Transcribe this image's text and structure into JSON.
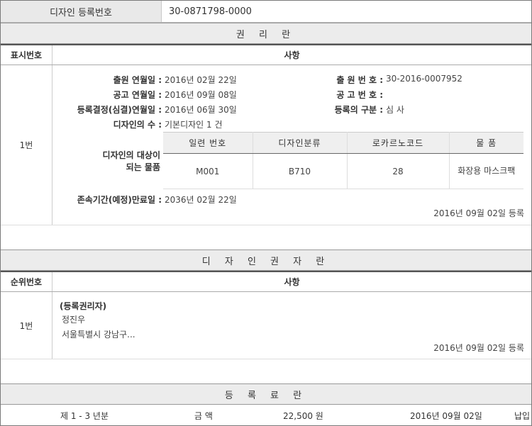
{
  "reg": {
    "label": "디자인 등록번호",
    "value": "30-0871798-0000"
  },
  "rights": {
    "title": "권 리 란",
    "col1": "표시번호",
    "col2": "사항",
    "row_num": "1번",
    "fields": {
      "app_date_k": "출원 연월일 :",
      "app_date_v": "2016년 02월 22일",
      "app_no_k": "출 원 번 호 :",
      "app_no_v": "30-2016-0007952",
      "pub_date_k": "공고 연월일 :",
      "pub_date_v": "2016년 09월 08일",
      "pub_no_k": "공 고 번 호 :",
      "pub_no_v": "",
      "decision_k": "등록결정(심결)연월일 :",
      "decision_v": "2016년 06월 30일",
      "reg_type_k": "등록의 구분 :",
      "reg_type_v": "심 사",
      "count_k": "디자인의 수 :",
      "count_v": "기본디자인 1 건",
      "target_k1": "디자인의 대상이",
      "target_k2": "되는 물품",
      "expiry_k": "존속기간(예정)만료일 :",
      "expiry_v": "2036년 02월 22일"
    },
    "goods_table": {
      "headers": [
        "일련 번호",
        "디자인분류",
        "로카르노코드",
        "물 품"
      ],
      "rows": [
        [
          "M001",
          "B710",
          "28",
          "화장용 마스크팩"
        ]
      ]
    },
    "registered_on": "2016년 09월 02일 등록"
  },
  "holders": {
    "title": "디 자 인 권 자 란",
    "col1": "순위번호",
    "col2": "사항",
    "row_num": "1번",
    "role": "(등록권리자)",
    "name": "정진우",
    "address": "서울특별시 강남구...",
    "registered_on": "2016년 09월 02일 등록"
  },
  "fees": {
    "title": "등 록 료 란",
    "period": "제 1 - 3 년분",
    "amount_label": "금 액",
    "amount": "22,500 원",
    "date": "2016년 09월 02일",
    "status": "납입"
  }
}
